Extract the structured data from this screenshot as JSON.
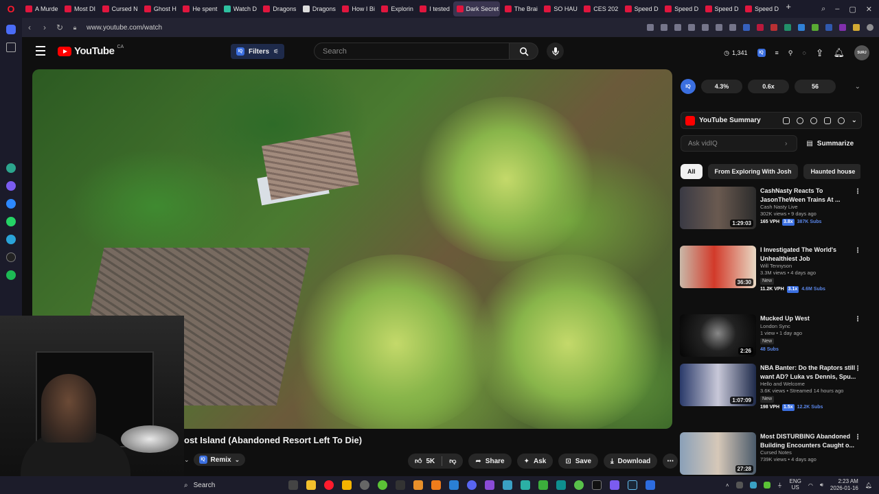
{
  "browser": {
    "tabs": [
      {
        "label": "A Murde",
        "color": "#e0163e"
      },
      {
        "label": "Most DI",
        "color": "#e0163e"
      },
      {
        "label": "Cursed N",
        "color": "#e0163e"
      },
      {
        "label": "Ghost H",
        "color": "#e0163e"
      },
      {
        "label": "He spent",
        "color": "#e0163e"
      },
      {
        "label": "Watch D",
        "color": "#2ec0a0"
      },
      {
        "label": "Dragons",
        "color": "#e0163e"
      },
      {
        "label": "Dragons",
        "color": "#dddddd"
      },
      {
        "label": "How I Bi",
        "color": "#e0163e"
      },
      {
        "label": "Explorin",
        "color": "#e0163e"
      },
      {
        "label": "I tested",
        "color": "#e0163e"
      },
      {
        "label": "Dark Secret",
        "color": "#e0163e",
        "active": true
      },
      {
        "label": "The Brai",
        "color": "#e0163e"
      },
      {
        "label": "SO HAU",
        "color": "#e0163e"
      },
      {
        "label": "CES 202",
        "color": "#e0163e"
      },
      {
        "label": "Speed D",
        "color": "#e0163e"
      },
      {
        "label": "Speed D",
        "color": "#e0163e"
      },
      {
        "label": "Speed D",
        "color": "#e0163e"
      },
      {
        "label": "Speed D",
        "color": "#e0163e"
      }
    ],
    "url": "www.youtube.com/watch"
  },
  "header": {
    "logo_text": "YouTube",
    "country": "CA",
    "filters_label": "Filters",
    "search_placeholder": "Search",
    "views_count": "1,341"
  },
  "video": {
    "title": "ost Island (Abandoned Resort Left To Die)",
    "remix_label": "Remix",
    "likes": "5K",
    "share_label": "Share",
    "ask_label": "Ask",
    "save_label": "Save",
    "download_label": "Download"
  },
  "vidiq": {
    "logo": "IQ",
    "stats": [
      "4.3%",
      "0.6x",
      "56"
    ]
  },
  "summary": {
    "title": "YouTube Summary",
    "ask_placeholder": "Ask vidIQ",
    "summarize_label": "Summarize"
  },
  "chips": [
    "All",
    "From Exploring With Josh",
    "Haunted house"
  ],
  "recommendations": [
    {
      "title": "CashNasty Reacts To JasonTheWeen Trains At ...",
      "channel": "Cash Nasty Live",
      "meta": "302K views • 9 days ago",
      "duration": "1:29:03",
      "vph": "165 VPH",
      "mult": "3.8x",
      "subs": "387K Subs",
      "new": ""
    },
    {
      "title": "I Investigated The World's Unhealthiest Job",
      "channel": "Will Tennyson",
      "meta": "3.3M views • 4 days ago",
      "duration": "36:30",
      "vph": "11.2K VPH",
      "mult": "3.1x",
      "subs": "4.6M Subs",
      "new": "New"
    },
    {
      "title": "Mucked Up West",
      "channel": "London Sync",
      "meta": "1 view • 1 day ago",
      "duration": "2:26",
      "vph": "",
      "mult": "",
      "subs": "48 Subs",
      "new": "New"
    },
    {
      "title": "NBA Banter: Do the Raptors still want AD? Luka vs Dennis, Spu...",
      "channel": "Hello and Welcome",
      "meta": "3.6K views • Streamed 14 hours ago",
      "duration": "1:07:09",
      "vph": "198 VPH",
      "mult": "1.5x",
      "subs": "12.2K Subs",
      "new": "New"
    },
    {
      "title": "Most DISTURBING Abandoned Building Encounters Caught o...",
      "channel": "Cursed Notes",
      "meta": "739K views • 4 days ago",
      "duration": "27:28",
      "vph": "",
      "mult": "",
      "subs": "",
      "new": ""
    }
  ],
  "taskbar": {
    "search_label": "Search",
    "lang": "ENG",
    "region": "US",
    "time": "2:23 AM",
    "date": "2026-01-16"
  }
}
